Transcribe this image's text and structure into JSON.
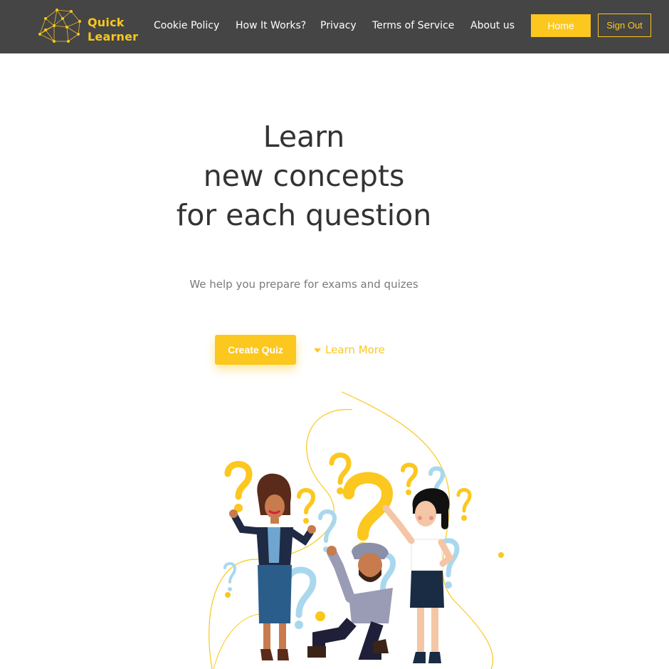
{
  "brand": {
    "line1": "Quick",
    "line2": "Learner",
    "accent": "#fcc71e",
    "nav_bg": "#454545"
  },
  "nav": {
    "links": [
      "Cookie Policy",
      "How It Works?",
      "Privacy",
      "Terms of Service",
      "About us"
    ],
    "home": "Home",
    "sign_out": "Sign Out"
  },
  "hero": {
    "title_lines": [
      "Learn",
      "new concepts",
      "for each question"
    ],
    "subtitle": "We help you prepare for exams and quizes",
    "cta_primary": "Create Quiz",
    "cta_secondary": "Learn More"
  },
  "illustration": {
    "subject": "three-people-with-question-marks"
  }
}
